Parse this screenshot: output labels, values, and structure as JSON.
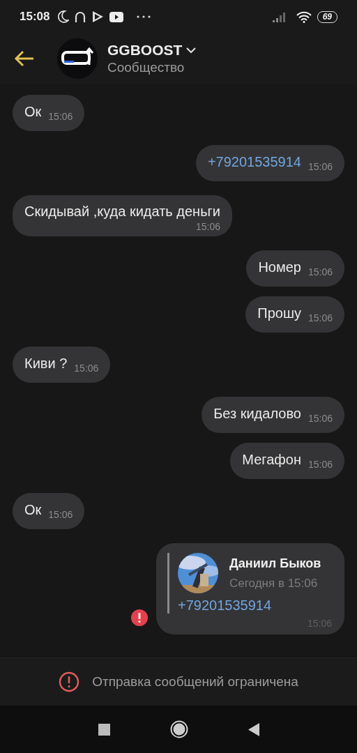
{
  "status_bar": {
    "time": "15:08",
    "battery": "69"
  },
  "header": {
    "title": "GGBOOST",
    "subtitle": "Сообщество"
  },
  "messages": [
    {
      "kind": "text",
      "outgoing": false,
      "text": "Ок",
      "time": "15:06",
      "time_below": false
    },
    {
      "kind": "link",
      "outgoing": true,
      "text": "+79201535914",
      "time": "15:06",
      "time_below": false
    },
    {
      "kind": "text",
      "outgoing": false,
      "text": "Скидывай ,куда кидать деньги",
      "time": "15:06",
      "time_below": true
    },
    {
      "kind": "text",
      "outgoing": true,
      "text": "Номер",
      "time": "15:06",
      "time_below": false
    },
    {
      "kind": "text",
      "outgoing": true,
      "text": "Прошу",
      "time": "15:06",
      "time_below": false
    },
    {
      "kind": "text",
      "outgoing": false,
      "text": "Киви ?",
      "time": "15:06",
      "time_below": false
    },
    {
      "kind": "text",
      "outgoing": true,
      "text": "Без кидалово",
      "time": "15:06",
      "time_below": false
    },
    {
      "kind": "text",
      "outgoing": true,
      "text": "Мегафон",
      "time": "15:06",
      "time_below": false
    },
    {
      "kind": "text",
      "outgoing": false,
      "text": "Ок",
      "time": "15:06",
      "time_below": false
    },
    {
      "kind": "forward",
      "outgoing": true,
      "author": "Даниил Быков",
      "date": "Сегодня в 15:06",
      "text": "+79201535914",
      "time": "15:06",
      "failed": true
    }
  ],
  "notice": {
    "text": "Отправка сообщений ограничена"
  }
}
